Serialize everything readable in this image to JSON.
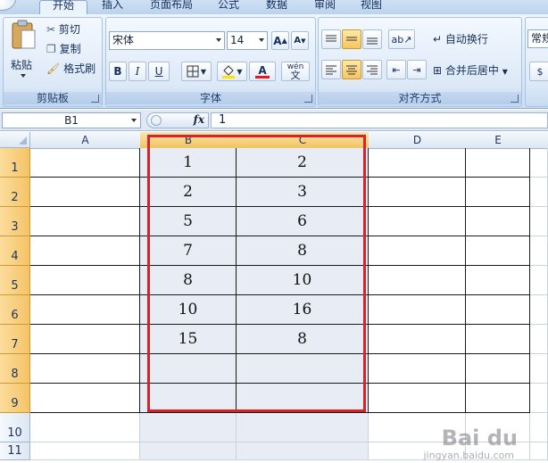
{
  "tabs": [
    "开始",
    "插入",
    "页面布局",
    "公式",
    "数据",
    "审阅",
    "视图"
  ],
  "clipboard": {
    "paste": "粘贴",
    "cut": "剪切",
    "copy": "复制",
    "format_painter": "格式刷",
    "group_label": "剪贴板"
  },
  "font": {
    "name": "宋体",
    "size": "14",
    "bold": "B",
    "italic": "I",
    "underline": "U",
    "font_color_letter": "A",
    "font_color": "#e41b1b",
    "phonetic": "wén",
    "group_label": "字体"
  },
  "alignment": {
    "wrap_text": "自动换行",
    "merge_center": "合并后居中",
    "group_label": "对齐方式"
  },
  "number": {
    "format": "常规"
  },
  "formula_bar": {
    "name_box": "B1",
    "fx": "fx",
    "value": "1"
  },
  "sheet": {
    "columns": [
      "A",
      "B",
      "C",
      "D",
      "E"
    ],
    "rows": [
      "1",
      "2",
      "3",
      "4",
      "5",
      "6",
      "7",
      "8",
      "9",
      "10",
      "11"
    ],
    "col_b": [
      "1",
      "2",
      "5",
      "7",
      "8",
      "10",
      "15",
      "",
      ""
    ],
    "col_c": [
      "2",
      "3",
      "6",
      "8",
      "10",
      "16",
      "8",
      "",
      ""
    ],
    "selection_color": "#d6232a"
  },
  "watermark": {
    "brand": "Bai du",
    "sub": "jingyan.baidu.com"
  }
}
